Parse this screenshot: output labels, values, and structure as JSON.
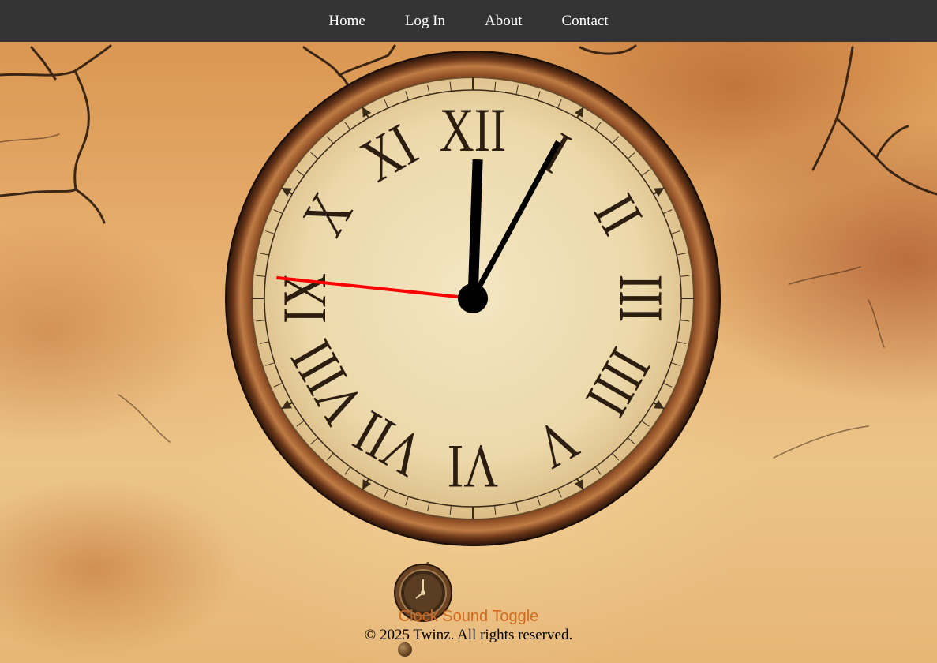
{
  "nav": {
    "items": [
      {
        "label": "Home"
      },
      {
        "label": "Log In"
      },
      {
        "label": "About"
      },
      {
        "label": "Contact"
      }
    ]
  },
  "clock": {
    "numerals": [
      "XII",
      "I",
      "II",
      "III",
      "IIII",
      "V",
      "VI",
      "VII",
      "VIII",
      "IX",
      "X",
      "XI"
    ],
    "time": {
      "hours": 12,
      "minutes": 4,
      "seconds": 46
    },
    "hand_colors": {
      "hour": "#000000",
      "minute": "#000000",
      "second": "#ff0000"
    }
  },
  "footer": {
    "sound_toggle_label": "Clock Sound Toggle",
    "copyright": "© 2025 Twinz. All rights reserved."
  },
  "colors": {
    "navbar": "#333333",
    "sound_toggle": "#d2691e"
  }
}
